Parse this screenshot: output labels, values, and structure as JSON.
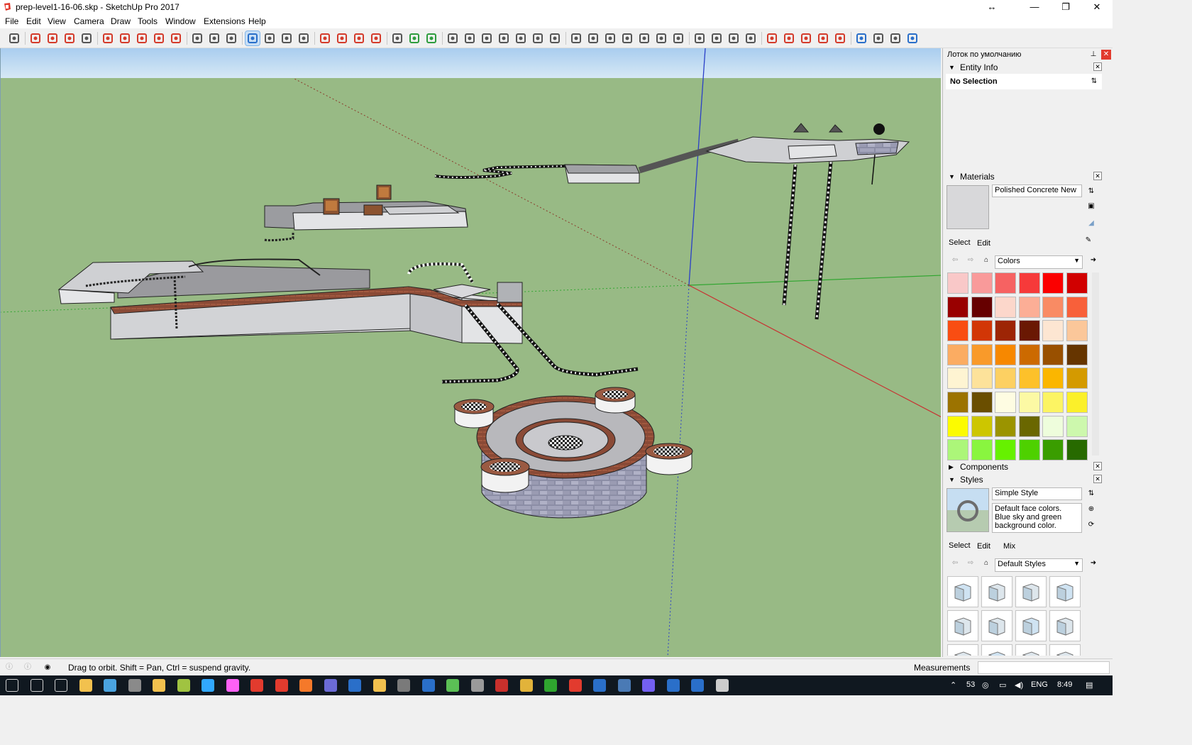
{
  "window": {
    "title": "prep-level1-16-06.skp - SketchUp Pro 2017",
    "controls": {
      "resize": "↔",
      "minimize": "—",
      "restore": "❐",
      "close": "✕"
    }
  },
  "menu": [
    "File",
    "Edit",
    "View",
    "Camera",
    "Draw",
    "Tools",
    "Window",
    "Extensions",
    "Help"
  ],
  "toolbar": {
    "buttons": [
      "select-tool",
      "eraser-tool",
      "pencil-tool",
      "arc-tool",
      "rectangle-tool",
      "push-pull-tool",
      "follow-me-tool",
      "move-tool",
      "rotate-tool",
      "scale-tool",
      "tape-measure-tool",
      "text-tool",
      "paint-bucket-tool",
      "orbit-tool",
      "pan-tool",
      "zoom-tool",
      "zoom-extents-tool",
      "warehouse",
      "extension-warehouse",
      "layout",
      "ruby-console",
      "section-plane",
      "components",
      "send-to-layout",
      "view-iso",
      "view-top",
      "view-front",
      "view-right",
      "view-back",
      "view-left",
      "styles-xray",
      "styles-backedges",
      "styles-wireframe",
      "styles-hidden",
      "styles-shaded",
      "styles-textured",
      "styles-monochrome",
      "section-display",
      "shadows",
      "fog",
      "sandbox",
      "advanced-camera",
      "axes",
      "guides",
      "dimension",
      "protractor",
      "walk",
      "look-around",
      "position-camera",
      "zoom-window",
      "zoom-previous"
    ],
    "active": [
      "orbit-tool"
    ],
    "icon_colors": {
      "red": "#d43b2b",
      "green": "#2e9c3e",
      "blue": "#2a6fc9",
      "gray": "#555555"
    }
  },
  "viewport": {
    "sky_color": "#b6d6ef",
    "ground_color": "#98ba85",
    "axis_colors": {
      "red": "#c83232",
      "green": "#2fa52f",
      "blue": "#2a3fc8"
    }
  },
  "tray": {
    "title": "Лоток по умолчанию",
    "entity_info": {
      "label": "Entity Info",
      "status": "No Selection"
    },
    "materials": {
      "label": "Materials",
      "current": "Polished Concrete New",
      "tabs": [
        "Select",
        "Edit"
      ],
      "library": "Colors",
      "swatches": [
        "#f9c8c8",
        "#f99a9a",
        "#f66262",
        "#f63a3a",
        "#fb0000",
        "#d10000",
        "#990000",
        "#660000",
        "#fcd7cb",
        "#fcae96",
        "#f98b64",
        "#f8603a",
        "#f94d12",
        "#d23606",
        "#9d2505",
        "#6a1803",
        "#fde6d2",
        "#fbc79a",
        "#fbac62",
        "#f99a2a",
        "#f78800",
        "#cc6a00",
        "#995000",
        "#663500",
        "#fef4d2",
        "#fde29a",
        "#fdd062",
        "#fdc12a",
        "#fbb600",
        "#d49a00",
        "#9c7300",
        "#6a4e00",
        "#fefce2",
        "#fcf9a4",
        "#fcf463",
        "#fbf02a",
        "#fcfb00",
        "#cdc600",
        "#9b9400",
        "#6a6700",
        "#eefddc",
        "#cdf8ad",
        "#acf679",
        "#89f53f",
        "#66f100",
        "#4ed100",
        "#3a9d00",
        "#276a00"
      ]
    },
    "components": {
      "label": "Components"
    },
    "styles": {
      "label": "Styles",
      "current": "Simple Style",
      "description": "Default face colors. Blue sky and green background color.",
      "tabs": [
        "Select",
        "Edit",
        "Mix"
      ],
      "library": "Default Styles",
      "thumbs": 12
    }
  },
  "status": {
    "hint": "Drag to orbit. Shift = Pan, Ctrl = suspend gravity.",
    "measurements_label": "Measurements",
    "measurements_value": ""
  },
  "taskbar": {
    "apps": [
      "start",
      "search",
      "task-view",
      "file-explorer",
      "app-1",
      "app-2",
      "app-3",
      "app-4",
      "photoshop",
      "adobe-xd",
      "sketchup",
      "sketchup-2",
      "blender",
      "app-5",
      "app-6",
      "app-7",
      "app-8",
      "app-9",
      "app-10",
      "app-11",
      "filezilla",
      "chrome",
      "app-12",
      "gmail",
      "app-13",
      "app-14",
      "viber",
      "app-15",
      "app-16",
      "app-17"
    ],
    "tray_text": {
      "count": "53",
      "language": "ENG",
      "time": "8:49"
    }
  }
}
